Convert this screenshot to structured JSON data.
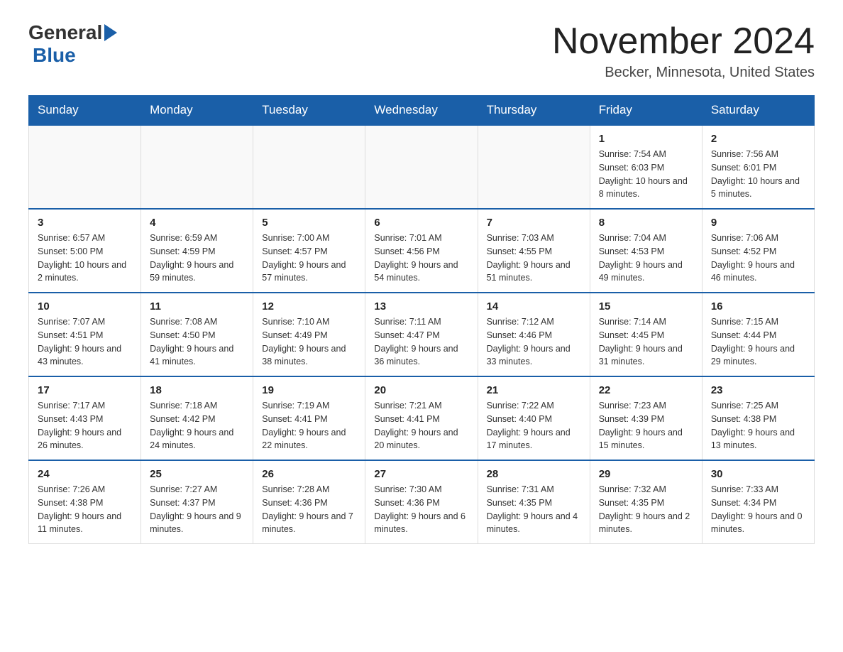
{
  "header": {
    "logo_general": "General",
    "logo_blue": "Blue",
    "month_title": "November 2024",
    "location": "Becker, Minnesota, United States"
  },
  "calendar": {
    "days_of_week": [
      "Sunday",
      "Monday",
      "Tuesday",
      "Wednesday",
      "Thursday",
      "Friday",
      "Saturday"
    ],
    "weeks": [
      [
        {
          "day": "",
          "info": ""
        },
        {
          "day": "",
          "info": ""
        },
        {
          "day": "",
          "info": ""
        },
        {
          "day": "",
          "info": ""
        },
        {
          "day": "",
          "info": ""
        },
        {
          "day": "1",
          "info": "Sunrise: 7:54 AM\nSunset: 6:03 PM\nDaylight: 10 hours and 8 minutes."
        },
        {
          "day": "2",
          "info": "Sunrise: 7:56 AM\nSunset: 6:01 PM\nDaylight: 10 hours and 5 minutes."
        }
      ],
      [
        {
          "day": "3",
          "info": "Sunrise: 6:57 AM\nSunset: 5:00 PM\nDaylight: 10 hours and 2 minutes."
        },
        {
          "day": "4",
          "info": "Sunrise: 6:59 AM\nSunset: 4:59 PM\nDaylight: 9 hours and 59 minutes."
        },
        {
          "day": "5",
          "info": "Sunrise: 7:00 AM\nSunset: 4:57 PM\nDaylight: 9 hours and 57 minutes."
        },
        {
          "day": "6",
          "info": "Sunrise: 7:01 AM\nSunset: 4:56 PM\nDaylight: 9 hours and 54 minutes."
        },
        {
          "day": "7",
          "info": "Sunrise: 7:03 AM\nSunset: 4:55 PM\nDaylight: 9 hours and 51 minutes."
        },
        {
          "day": "8",
          "info": "Sunrise: 7:04 AM\nSunset: 4:53 PM\nDaylight: 9 hours and 49 minutes."
        },
        {
          "day": "9",
          "info": "Sunrise: 7:06 AM\nSunset: 4:52 PM\nDaylight: 9 hours and 46 minutes."
        }
      ],
      [
        {
          "day": "10",
          "info": "Sunrise: 7:07 AM\nSunset: 4:51 PM\nDaylight: 9 hours and 43 minutes."
        },
        {
          "day": "11",
          "info": "Sunrise: 7:08 AM\nSunset: 4:50 PM\nDaylight: 9 hours and 41 minutes."
        },
        {
          "day": "12",
          "info": "Sunrise: 7:10 AM\nSunset: 4:49 PM\nDaylight: 9 hours and 38 minutes."
        },
        {
          "day": "13",
          "info": "Sunrise: 7:11 AM\nSunset: 4:47 PM\nDaylight: 9 hours and 36 minutes."
        },
        {
          "day": "14",
          "info": "Sunrise: 7:12 AM\nSunset: 4:46 PM\nDaylight: 9 hours and 33 minutes."
        },
        {
          "day": "15",
          "info": "Sunrise: 7:14 AM\nSunset: 4:45 PM\nDaylight: 9 hours and 31 minutes."
        },
        {
          "day": "16",
          "info": "Sunrise: 7:15 AM\nSunset: 4:44 PM\nDaylight: 9 hours and 29 minutes."
        }
      ],
      [
        {
          "day": "17",
          "info": "Sunrise: 7:17 AM\nSunset: 4:43 PM\nDaylight: 9 hours and 26 minutes."
        },
        {
          "day": "18",
          "info": "Sunrise: 7:18 AM\nSunset: 4:42 PM\nDaylight: 9 hours and 24 minutes."
        },
        {
          "day": "19",
          "info": "Sunrise: 7:19 AM\nSunset: 4:41 PM\nDaylight: 9 hours and 22 minutes."
        },
        {
          "day": "20",
          "info": "Sunrise: 7:21 AM\nSunset: 4:41 PM\nDaylight: 9 hours and 20 minutes."
        },
        {
          "day": "21",
          "info": "Sunrise: 7:22 AM\nSunset: 4:40 PM\nDaylight: 9 hours and 17 minutes."
        },
        {
          "day": "22",
          "info": "Sunrise: 7:23 AM\nSunset: 4:39 PM\nDaylight: 9 hours and 15 minutes."
        },
        {
          "day": "23",
          "info": "Sunrise: 7:25 AM\nSunset: 4:38 PM\nDaylight: 9 hours and 13 minutes."
        }
      ],
      [
        {
          "day": "24",
          "info": "Sunrise: 7:26 AM\nSunset: 4:38 PM\nDaylight: 9 hours and 11 minutes."
        },
        {
          "day": "25",
          "info": "Sunrise: 7:27 AM\nSunset: 4:37 PM\nDaylight: 9 hours and 9 minutes."
        },
        {
          "day": "26",
          "info": "Sunrise: 7:28 AM\nSunset: 4:36 PM\nDaylight: 9 hours and 7 minutes."
        },
        {
          "day": "27",
          "info": "Sunrise: 7:30 AM\nSunset: 4:36 PM\nDaylight: 9 hours and 6 minutes."
        },
        {
          "day": "28",
          "info": "Sunrise: 7:31 AM\nSunset: 4:35 PM\nDaylight: 9 hours and 4 minutes."
        },
        {
          "day": "29",
          "info": "Sunrise: 7:32 AM\nSunset: 4:35 PM\nDaylight: 9 hours and 2 minutes."
        },
        {
          "day": "30",
          "info": "Sunrise: 7:33 AM\nSunset: 4:34 PM\nDaylight: 9 hours and 0 minutes."
        }
      ]
    ]
  }
}
